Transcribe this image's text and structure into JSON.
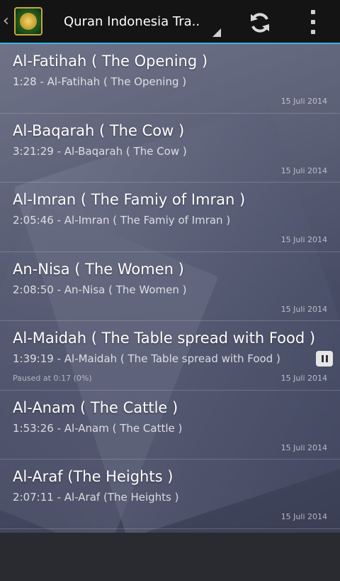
{
  "actionbar": {
    "title": "Quran Indonesia Tra..",
    "icons": {
      "up": "chevron-left-icon",
      "app": "quran-app-icon",
      "refresh": "refresh-icon",
      "overflow": "overflow-menu-icon"
    }
  },
  "list": {
    "items": [
      {
        "name": "Al-Fatihah ( The Opening )",
        "subtitle": "1:28 - Al-Fatihah ( The Opening )",
        "date": "15 Juli 2014"
      },
      {
        "name": "Al-Baqarah ( The Cow )",
        "subtitle": "3:21:29 - Al-Baqarah ( The Cow )",
        "date": "15 Juli 2014"
      },
      {
        "name": "Al-Imran ( The Famiy of Imran )",
        "subtitle": "2:05:46 - Al-Imran ( The Famiy of Imran )",
        "date": "15 Juli 2014"
      },
      {
        "name": "An-Nisa ( The Women )",
        "subtitle": "2:08:50 - An-Nisa ( The Women )",
        "date": "15 Juli 2014"
      },
      {
        "name": "Al-Maidah ( The Table spread with Food )",
        "subtitle": "1:39:19 - Al-Maidah ( The Table spread with Food )",
        "status": "Paused at 0:17 (0%)",
        "date": "15 Juli 2014",
        "pause_icon": "pause-icon"
      },
      {
        "name": "Al-Anam ( The Cattle )",
        "subtitle": "1:53:26 - Al-Anam ( The Cattle )",
        "date": "15 Juli 2014"
      },
      {
        "name": "Al-Araf (The Heights )",
        "subtitle": "2:07:11 - Al-Araf (The Heights )",
        "date": "15 Juli 2014"
      }
    ]
  },
  "colors": {
    "accent": "#33b5e5",
    "actionbar": "#141414"
  }
}
